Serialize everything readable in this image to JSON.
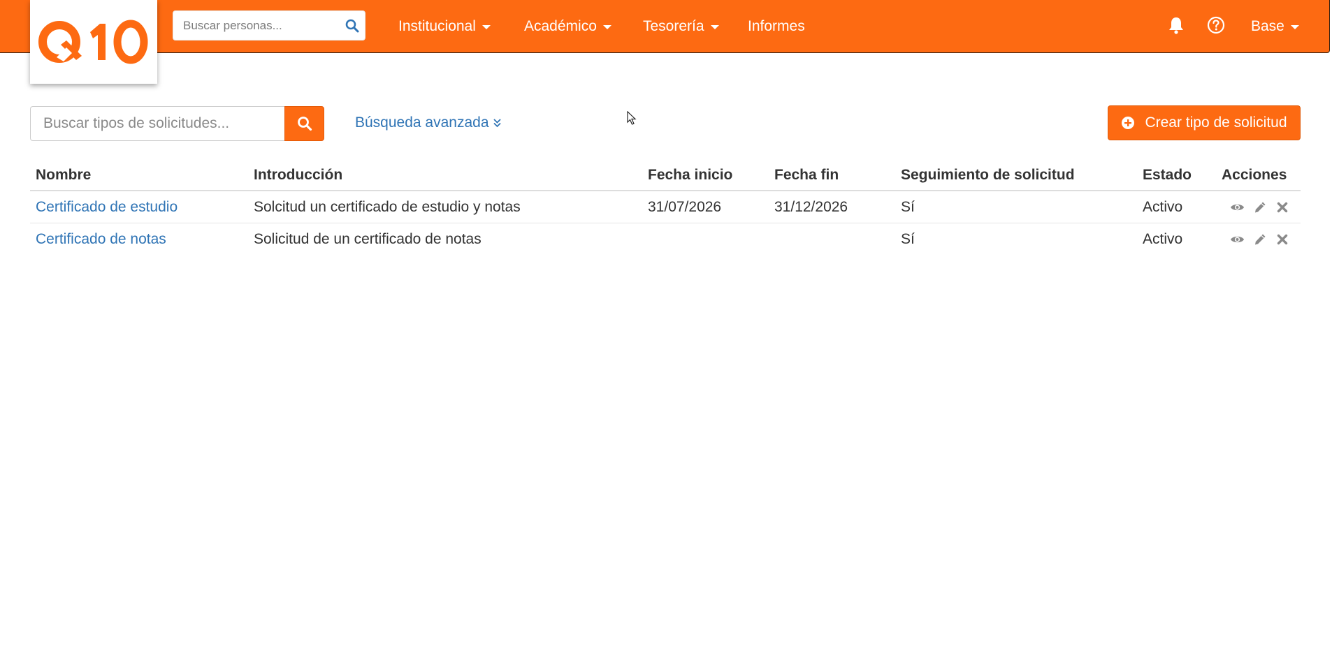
{
  "brand": {
    "logo_text": "Q10",
    "color": "#fd6a12"
  },
  "nav": {
    "search_placeholder": "Buscar personas...",
    "menus": [
      {
        "label": "Institucional",
        "has_dropdown": true
      },
      {
        "label": "Académico",
        "has_dropdown": true
      },
      {
        "label": "Tesorería",
        "has_dropdown": true
      },
      {
        "label": "Informes",
        "has_dropdown": false
      }
    ],
    "icons": [
      "bell-icon",
      "help-icon"
    ],
    "user_menu": {
      "label": "Base",
      "has_dropdown": true
    }
  },
  "toolbar": {
    "search_placeholder": "Buscar tipos de solicitudes...",
    "advanced_search_label": "Búsqueda avanzada",
    "create_label": "Crear tipo de solicitud"
  },
  "table": {
    "columns": [
      "Nombre",
      "Introducción",
      "Fecha inicio",
      "Fecha fin",
      "Seguimiento de solicitud",
      "Estado",
      "Acciones"
    ],
    "rows": [
      {
        "nombre": "Certificado de estudio",
        "introduccion": "Solcitud un certificado de estudio y notas",
        "fecha_inicio": "31/07/2026",
        "fecha_fin": "31/12/2026",
        "seguimiento": "Sí",
        "estado": "Activo"
      },
      {
        "nombre": "Certificado de notas",
        "introduccion": "Solicitud de un certificado de notas",
        "fecha_inicio": "",
        "fecha_fin": "",
        "seguimiento": "Sí",
        "estado": "Activo"
      }
    ],
    "row_actions": [
      "view-icon",
      "edit-icon",
      "delete-icon"
    ]
  }
}
